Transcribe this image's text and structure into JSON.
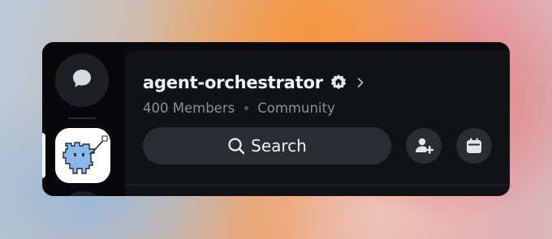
{
  "server": {
    "name": "agent-orchestrator",
    "member_count": "400 Members",
    "type": "Community"
  },
  "search": {
    "label": "Search"
  },
  "icons": {
    "dm": "chat-bubble-icon",
    "badge": "community-home-badge-icon",
    "chevron": "chevron-right-icon",
    "search": "search-icon",
    "invite": "add-member-icon",
    "events": "calendar-icon"
  },
  "colors": {
    "panel": "#111216",
    "button": "#2b2d33",
    "text": "#f2f3f5",
    "muted": "#8e9097"
  }
}
